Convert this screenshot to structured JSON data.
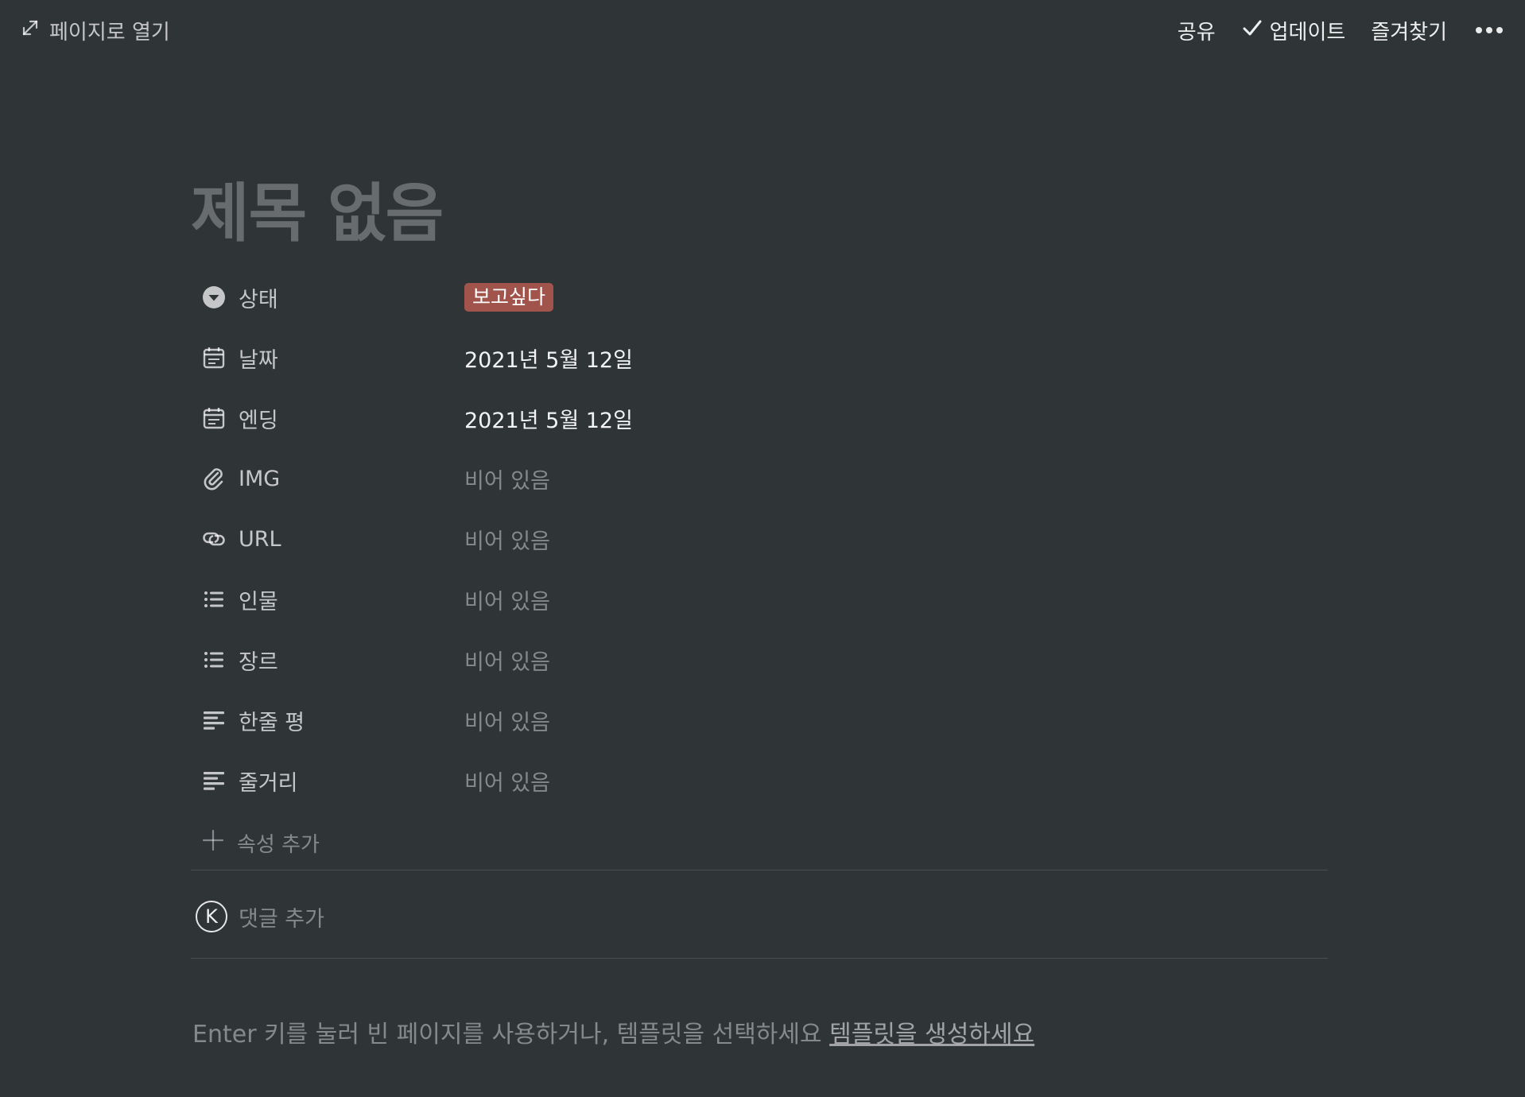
{
  "topbar": {
    "open_page_label": "페이지로 열기",
    "share_label": "공유",
    "updates_label": "업데이트",
    "favorite_label": "즐겨찾기"
  },
  "page": {
    "title": "제목 없음"
  },
  "properties": [
    {
      "name": "상태",
      "icon": "select-icon",
      "value": "보고싶다",
      "kind": "tag",
      "tag_color": "#a0544c"
    },
    {
      "name": "날짜",
      "icon": "calendar-icon",
      "value": "2021년 5월 12일",
      "kind": "date"
    },
    {
      "name": "엔딩",
      "icon": "calendar-icon",
      "value": "2021년 5월 12일",
      "kind": "date"
    },
    {
      "name": "IMG",
      "icon": "attachment-icon",
      "value": "비어 있음",
      "kind": "empty"
    },
    {
      "name": "URL",
      "icon": "link-icon",
      "value": "비어 있음",
      "kind": "empty"
    },
    {
      "name": "인물",
      "icon": "multi-select-icon",
      "value": "비어 있음",
      "kind": "empty"
    },
    {
      "name": "장르",
      "icon": "multi-select-icon",
      "value": "비어 있음",
      "kind": "empty"
    },
    {
      "name": "한줄 평",
      "icon": "text-icon",
      "value": "비어 있음",
      "kind": "empty"
    },
    {
      "name": "줄거리",
      "icon": "text-icon",
      "value": "비어 있음",
      "kind": "empty"
    }
  ],
  "add_property_label": "속성 추가",
  "comment": {
    "avatar_initial": "K",
    "placeholder": "댓글 추가"
  },
  "hint": {
    "text": "Enter 키를 눌러 빈 페이지를 사용하거나, 템플릿을 선택하세요 ",
    "link": "템플릿을 생성하세요"
  }
}
